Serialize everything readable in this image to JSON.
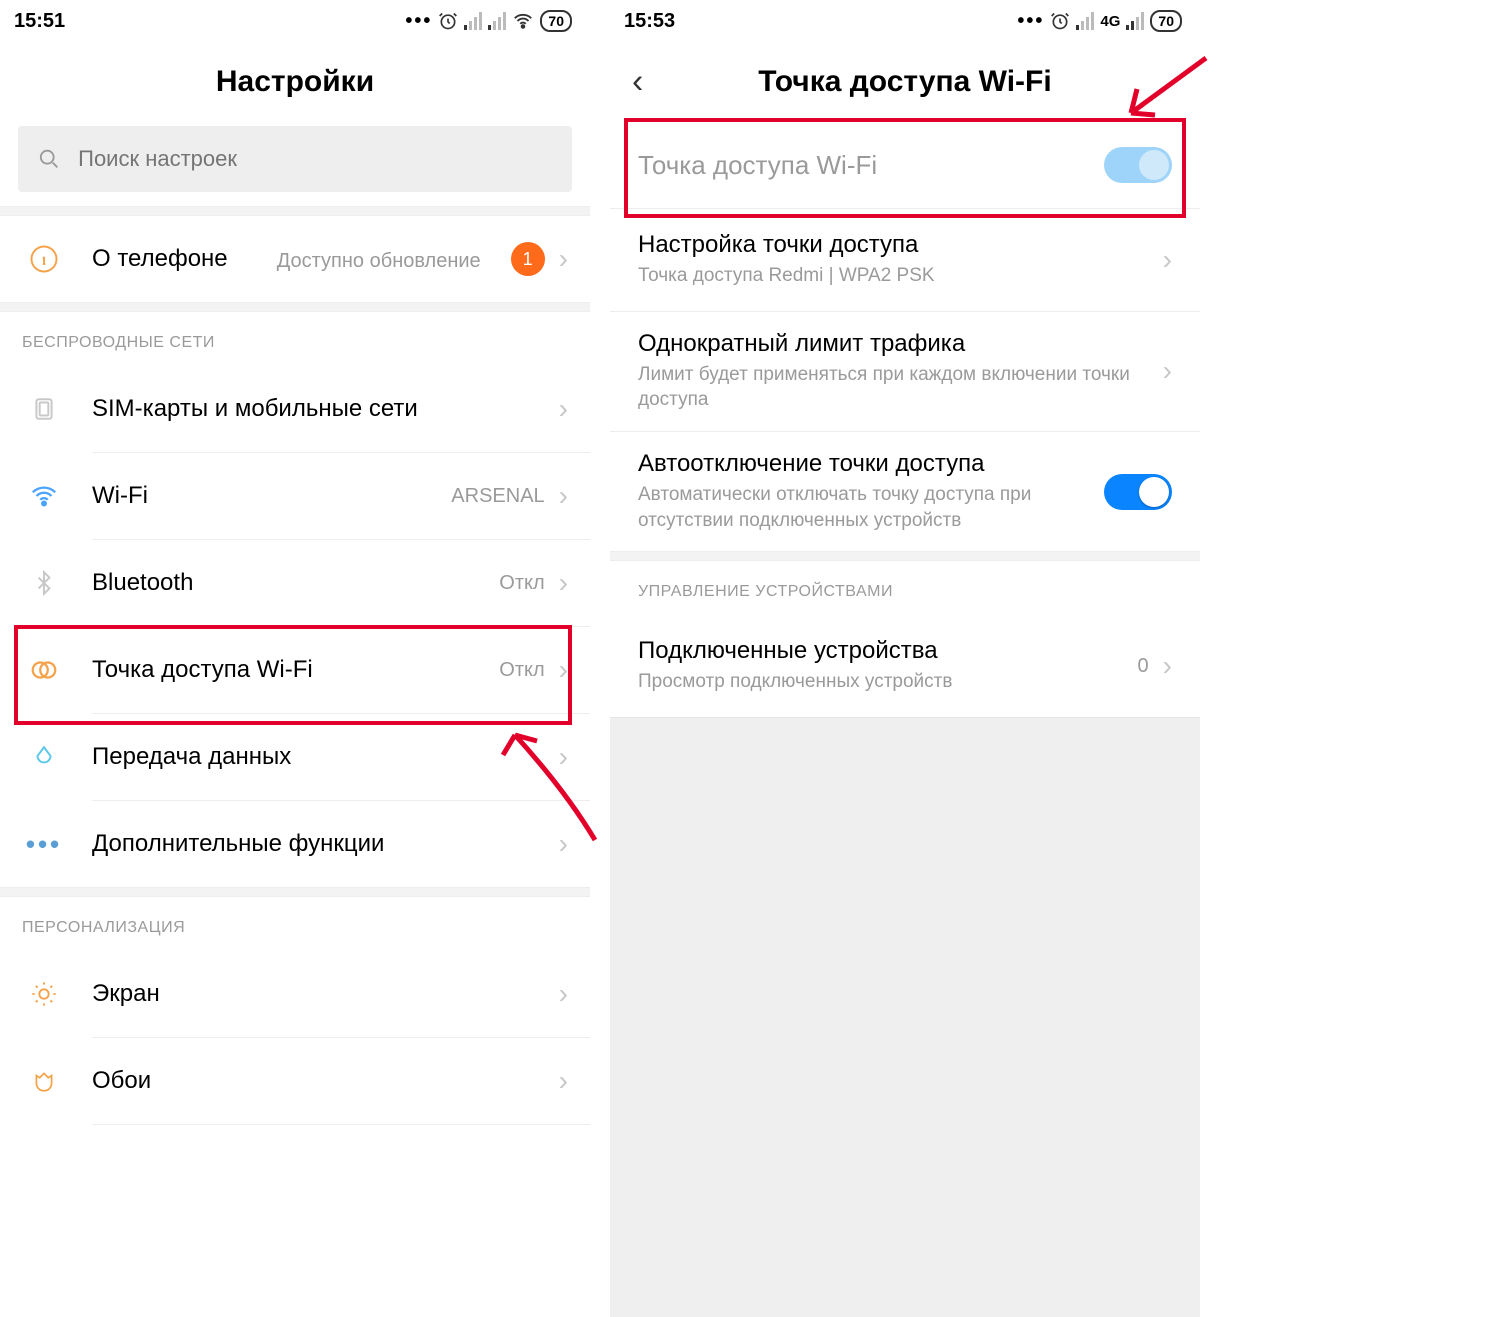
{
  "left": {
    "status": {
      "time": "15:51",
      "battery": "70"
    },
    "title": "Настройки",
    "search_placeholder": "Поиск настроек",
    "about": {
      "label": "О телефоне",
      "sub": "Доступно обновление",
      "badge": "1"
    },
    "section_wireless": "БЕСПРОВОДНЫЕ СЕТИ",
    "rows": {
      "sim": "SIM-карты и мобильные сети",
      "wifi": "Wi-Fi",
      "wifi_value": "ARSENAL",
      "bt": "Bluetooth",
      "bt_value": "Откл",
      "hotspot": "Точка доступа Wi-Fi",
      "hotspot_value": "Откл",
      "data": "Передача данных",
      "more": "Дополнительные функции"
    },
    "section_personal": "ПЕРСОНАЛИЗАЦИЯ",
    "screen": "Экран",
    "wallpaper": "Обои"
  },
  "right": {
    "status": {
      "time": "15:53",
      "net": "4G",
      "battery": "70"
    },
    "title": "Точка доступа Wi-Fi",
    "ap_toggle_label": "Точка доступа Wi-Fi",
    "config": {
      "label": "Настройка точки доступа",
      "sub": "Точка доступа Redmi | WPA2 PSK"
    },
    "limit": {
      "label": "Однократный лимит трафика",
      "sub": "Лимит будет применяться при каждом включении точки доступа"
    },
    "auto_off": {
      "label": "Автоотключение точки доступа",
      "sub": "Автоматически отключать точку доступа при отсутствии подключенных устройств"
    },
    "section_devices": "УПРАВЛЕНИЕ УСТРОЙСТВАМИ",
    "connected": {
      "label": "Подключенные устройства",
      "sub": "Просмотр подключенных устройств",
      "count": "0"
    }
  }
}
